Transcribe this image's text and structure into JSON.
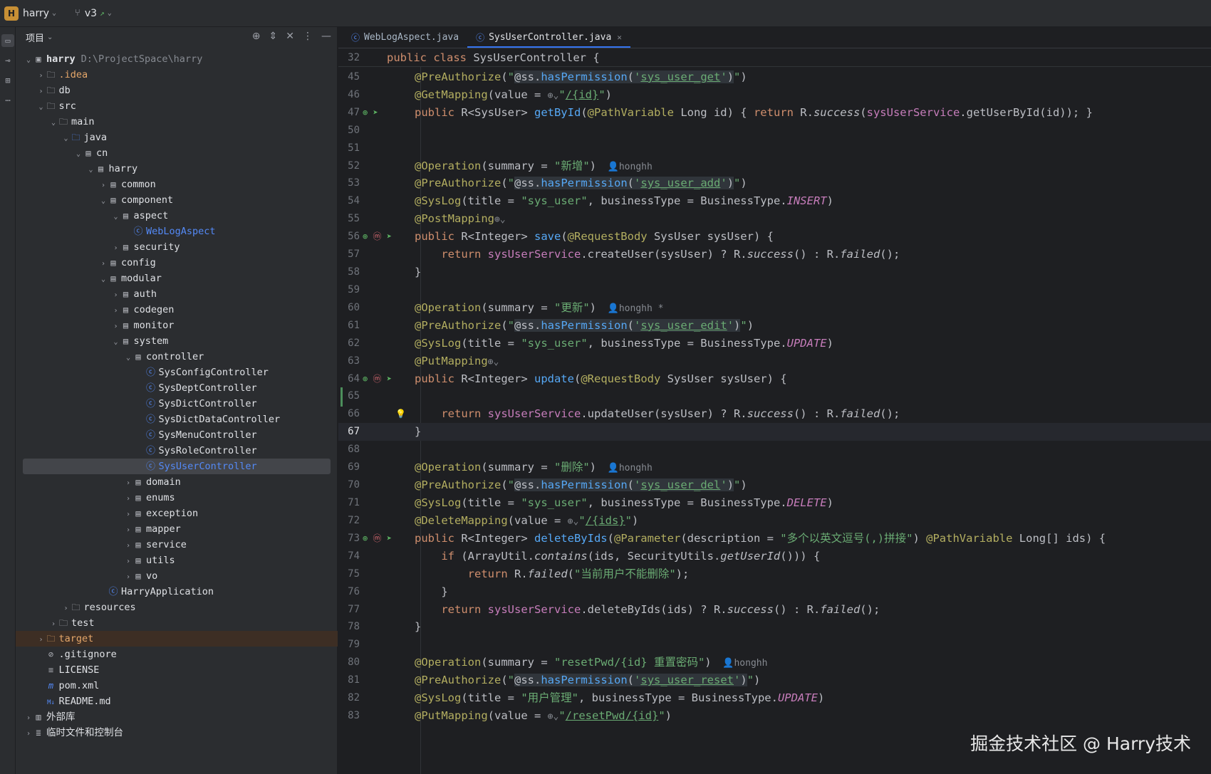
{
  "titlebar": {
    "project_badge": "H",
    "project_name": "harry",
    "branch": "v3"
  },
  "project_panel": {
    "title": "项目",
    "tree": [
      {
        "depth": 0,
        "arrow": "open",
        "icon": "module-icon",
        "label": "harry",
        "bold": true,
        "hint": "D:\\ProjectSpace\\harry"
      },
      {
        "depth": 1,
        "arrow": "closed",
        "icon": "folder-icon",
        "label": ".idea",
        "style": "idea"
      },
      {
        "depth": 1,
        "arrow": "closed",
        "icon": "folder-icon",
        "label": "db"
      },
      {
        "depth": 1,
        "arrow": "open",
        "icon": "folder-icon",
        "label": "src"
      },
      {
        "depth": 2,
        "arrow": "open",
        "icon": "folder-icon",
        "label": "main"
      },
      {
        "depth": 3,
        "arrow": "open",
        "icon": "source-folder-icon",
        "label": "java"
      },
      {
        "depth": 4,
        "arrow": "open",
        "icon": "package-icon",
        "label": "cn"
      },
      {
        "depth": 5,
        "arrow": "open",
        "icon": "package-icon",
        "label": "harry"
      },
      {
        "depth": 6,
        "arrow": "closed",
        "icon": "package-icon",
        "label": "common"
      },
      {
        "depth": 6,
        "arrow": "open",
        "icon": "package-icon",
        "label": "component"
      },
      {
        "depth": 7,
        "arrow": "open",
        "icon": "package-icon",
        "label": "aspect"
      },
      {
        "depth": 8,
        "arrow": "none",
        "icon": "class-icon",
        "label": "WebLogAspect",
        "style": "cls"
      },
      {
        "depth": 7,
        "arrow": "closed",
        "icon": "package-icon",
        "label": "security"
      },
      {
        "depth": 6,
        "arrow": "closed",
        "icon": "package-icon",
        "label": "config"
      },
      {
        "depth": 6,
        "arrow": "open",
        "icon": "package-icon",
        "label": "modular"
      },
      {
        "depth": 7,
        "arrow": "closed",
        "icon": "package-icon",
        "label": "auth"
      },
      {
        "depth": 7,
        "arrow": "closed",
        "icon": "package-icon",
        "label": "codegen"
      },
      {
        "depth": 7,
        "arrow": "closed",
        "icon": "package-icon",
        "label": "monitor"
      },
      {
        "depth": 7,
        "arrow": "open",
        "icon": "package-icon",
        "label": "system"
      },
      {
        "depth": 8,
        "arrow": "open",
        "icon": "package-icon",
        "label": "controller"
      },
      {
        "depth": 9,
        "arrow": "none",
        "icon": "class-icon",
        "label": "SysConfigController"
      },
      {
        "depth": 9,
        "arrow": "none",
        "icon": "class-icon",
        "label": "SysDeptController"
      },
      {
        "depth": 9,
        "arrow": "none",
        "icon": "class-icon",
        "label": "SysDictController"
      },
      {
        "depth": 9,
        "arrow": "none",
        "icon": "class-icon",
        "label": "SysDictDataController"
      },
      {
        "depth": 9,
        "arrow": "none",
        "icon": "class-icon",
        "label": "SysMenuController"
      },
      {
        "depth": 9,
        "arrow": "none",
        "icon": "class-icon",
        "label": "SysRoleController"
      },
      {
        "depth": 9,
        "arrow": "none",
        "icon": "class-icon",
        "label": "SysUserController",
        "style": "cls",
        "selected": true
      },
      {
        "depth": 8,
        "arrow": "closed",
        "icon": "package-icon",
        "label": "domain"
      },
      {
        "depth": 8,
        "arrow": "closed",
        "icon": "package-icon",
        "label": "enums"
      },
      {
        "depth": 8,
        "arrow": "closed",
        "icon": "package-icon",
        "label": "exception"
      },
      {
        "depth": 8,
        "arrow": "closed",
        "icon": "package-icon",
        "label": "mapper"
      },
      {
        "depth": 8,
        "arrow": "closed",
        "icon": "package-icon",
        "label": "service"
      },
      {
        "depth": 8,
        "arrow": "closed",
        "icon": "package-icon",
        "label": "utils"
      },
      {
        "depth": 8,
        "arrow": "closed",
        "icon": "package-icon",
        "label": "vo"
      },
      {
        "depth": 6,
        "arrow": "none",
        "icon": "spring-boot-class-icon",
        "label": "HarryApplication"
      },
      {
        "depth": 3,
        "arrow": "closed",
        "icon": "resources-folder-icon",
        "label": "resources"
      },
      {
        "depth": 2,
        "arrow": "closed",
        "icon": "folder-icon",
        "label": "test"
      },
      {
        "depth": 1,
        "arrow": "closed",
        "icon": "folder-icon",
        "label": "target",
        "style": "target"
      },
      {
        "depth": 1,
        "arrow": "none",
        "icon": "ignore-file-icon",
        "label": ".gitignore"
      },
      {
        "depth": 1,
        "arrow": "none",
        "icon": "text-file-icon",
        "label": "LICENSE"
      },
      {
        "depth": 1,
        "arrow": "none",
        "icon": "maven-icon",
        "label": "pom.xml"
      },
      {
        "depth": 1,
        "arrow": "none",
        "icon": "markdown-icon",
        "label": "README.md"
      },
      {
        "depth": 0,
        "arrow": "closed",
        "icon": "library-icon",
        "label": "外部库"
      },
      {
        "depth": 0,
        "arrow": "closed",
        "icon": "scratches-icon",
        "label": "临时文件和控制台"
      }
    ]
  },
  "editor": {
    "tabs": [
      {
        "label": "WebLogAspect.java",
        "active": false
      },
      {
        "label": "SysUserController.java",
        "active": true
      }
    ],
    "sticky": {
      "num": "32",
      "code": "public class SysUserController {"
    },
    "lines": [
      {
        "num": "45",
        "code": "@PreAuthorize(\"@ss.hasPermission('sys_user_get')\")"
      },
      {
        "num": "46",
        "code": "@GetMapping(value = \"/{id}\")"
      },
      {
        "num": "47",
        "code": "public R<SysUser> getById(@PathVariable Long id) { return R.success(sysUserService.getUserById(id)); }"
      },
      {
        "num": "50",
        "code": ""
      },
      {
        "num": "51",
        "code": ""
      },
      {
        "num": "52",
        "code": "@Operation(summary = \"新增\")",
        "author": "honghh"
      },
      {
        "num": "53",
        "code": "@PreAuthorize(\"@ss.hasPermission('sys_user_add')\")"
      },
      {
        "num": "54",
        "code": "@SysLog(title = \"sys_user\", businessType = BusinessType.INSERT)"
      },
      {
        "num": "55",
        "code": "@PostMapping"
      },
      {
        "num": "56",
        "code": "public R<Integer> save(@RequestBody SysUser sysUser) {"
      },
      {
        "num": "57",
        "code": "    return sysUserService.createUser(sysUser) ? R.success() : R.failed();"
      },
      {
        "num": "58",
        "code": "}"
      },
      {
        "num": "59",
        "code": ""
      },
      {
        "num": "60",
        "code": "@Operation(summary = \"更新\")",
        "author": "honghh *"
      },
      {
        "num": "61",
        "code": "@PreAuthorize(\"@ss.hasPermission('sys_user_edit')\")"
      },
      {
        "num": "62",
        "code": "@SysLog(title = \"sys_user\", businessType = BusinessType.UPDATE)"
      },
      {
        "num": "63",
        "code": "@PutMapping"
      },
      {
        "num": "64",
        "code": "public R<Integer> update(@RequestBody SysUser sysUser) {"
      },
      {
        "num": "65",
        "code": ""
      },
      {
        "num": "66",
        "code": "    return sysUserService.updateUser(sysUser) ? R.success() : R.failed();"
      },
      {
        "num": "67",
        "code": "}"
      },
      {
        "num": "68",
        "code": ""
      },
      {
        "num": "69",
        "code": "@Operation(summary = \"删除\")",
        "author": "honghh"
      },
      {
        "num": "70",
        "code": "@PreAuthorize(\"@ss.hasPermission('sys_user_del')\")"
      },
      {
        "num": "71",
        "code": "@SysLog(title = \"sys_user\", businessType = BusinessType.DELETE)"
      },
      {
        "num": "72",
        "code": "@DeleteMapping(value = \"/{ids}\")"
      },
      {
        "num": "73",
        "code": "public R<Integer> deleteByIds(@Parameter(description = \"多个以英文逗号(,)拼接\") @PathVariable Long[] ids) {"
      },
      {
        "num": "74",
        "code": "    if (ArrayUtil.contains(ids, SecurityUtils.getUserId())) {"
      },
      {
        "num": "75",
        "code": "        return R.failed(\"当前用户不能删除\");"
      },
      {
        "num": "76",
        "code": "    }"
      },
      {
        "num": "77",
        "code": "    return sysUserService.deleteByIds(ids) ? R.success() : R.failed();"
      },
      {
        "num": "78",
        "code": "}"
      },
      {
        "num": "79",
        "code": ""
      },
      {
        "num": "80",
        "code": "@Operation(summary = \"resetPwd/{id} 重置密码\")",
        "author": "honghh"
      },
      {
        "num": "81",
        "code": "@PreAuthorize(\"@ss.hasPermission('sys_user_reset')\")"
      },
      {
        "num": "82",
        "code": "@SysLog(title = \"用户管理\", businessType = BusinessType.UPDATE)"
      },
      {
        "num": "83",
        "code": "@PutMapping(value = \"/resetPwd/{id}\")"
      }
    ],
    "current_line": "67"
  },
  "watermark": "掘金技术社区 @ Harry技术",
  "colors": {
    "background": "#1e1f22",
    "panel": "#2b2d30",
    "accent": "#3574f0",
    "keyword": "#cf8e6d",
    "annotation": "#b3ae60",
    "string": "#6aab73",
    "method": "#56a8f5"
  }
}
